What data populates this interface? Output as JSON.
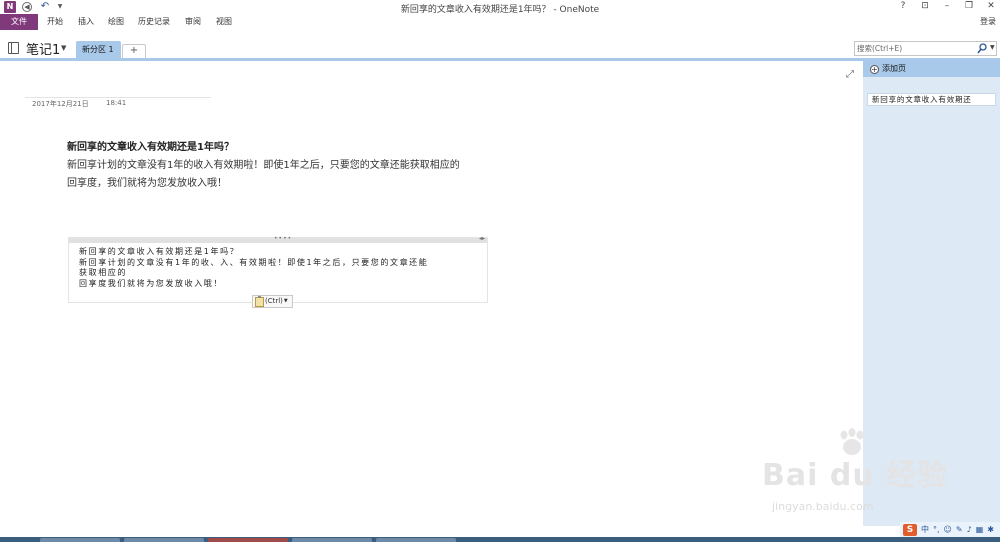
{
  "window": {
    "title": "新回享的文章收入有效期还是1年吗？ - OneNote",
    "logo_letter": "N",
    "controls": [
      "?",
      "⊡",
      "–",
      "❐",
      "✕"
    ]
  },
  "ribbon": {
    "file_label": "文件",
    "tabs": [
      "开始",
      "插入",
      "绘图",
      "历史记录",
      "审阅",
      "视图"
    ],
    "sign_in": "登录"
  },
  "notebook": {
    "name": "笔记1",
    "section": "新分区 1",
    "add_section": "+"
  },
  "search": {
    "placeholder": "搜索(Ctrl+E)"
  },
  "page": {
    "date": "2017年12月21日",
    "time": "18:41",
    "heading": "新回享的文章收入有效期还是1年吗？",
    "body_line1": "新回享计划的文章没有1年的收入有效期啦！即使1年之后，只要您的文章还能获取相应的",
    "body_line2": "回享度，我们就将为您发放收入哦！"
  },
  "pasted": {
    "line1": "新回享的文章收入有效期还是1年吗？",
    "line2": "新回享计划的文章没有1年的收、入、有效期啦！即使1年之后，只要您的文章还能",
    "line3": "获取相应的",
    "line4": "回享度我们就将为您发放收入哦！",
    "paste_options": "(Ctrl)"
  },
  "page_pane": {
    "add_page": "添加页",
    "pages": [
      "新回享的文章收入有效期还"
    ]
  },
  "watermark": {
    "main": "Bai  du 经验",
    "sub": "jingyan.baidu.com"
  },
  "ime": {
    "logo": "S",
    "mode": "中",
    "punct": "°,"
  },
  "colors": {
    "accent_purple": "#80397b",
    "section_blue": "#a8c9ea",
    "pane_bg": "#dde9f5"
  }
}
